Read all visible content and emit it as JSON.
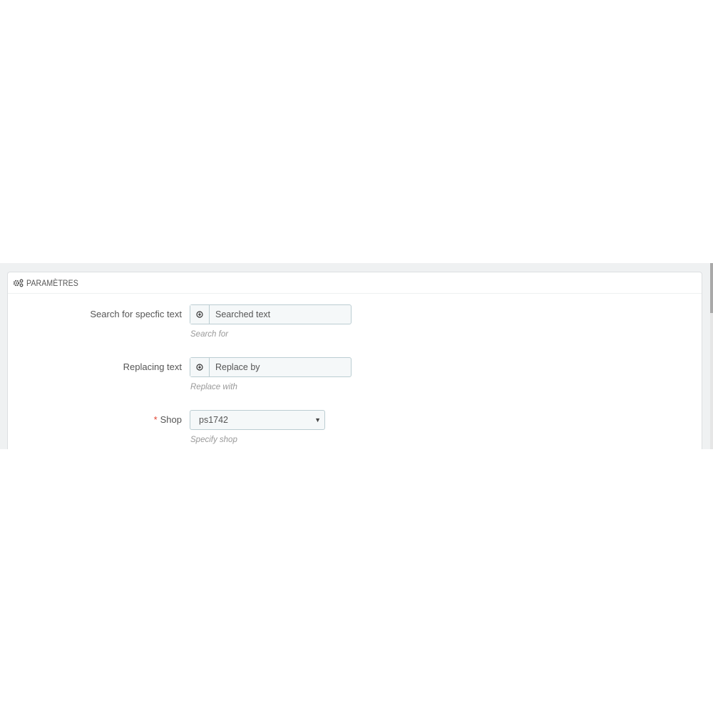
{
  "panel": {
    "title": "PARAMÈTRES",
    "icon": "cogs-icon"
  },
  "fields": [
    {
      "label": "Search for specfic text",
      "required": false,
      "value": "Searched text",
      "addon_icon": "download-circle-icon",
      "help": "Search for"
    },
    {
      "label": "Replacing text",
      "required": false,
      "value": "Replace by",
      "addon_icon": "download-circle-icon",
      "help": "Replace with"
    },
    {
      "label": "Shop",
      "required": true,
      "required_mark": "*",
      "value": "ps1742",
      "help": "Specify shop"
    }
  ],
  "colors": {
    "required": "#e0412e",
    "input_border": "#bbcdd2",
    "input_bg": "#f5f8f9"
  }
}
